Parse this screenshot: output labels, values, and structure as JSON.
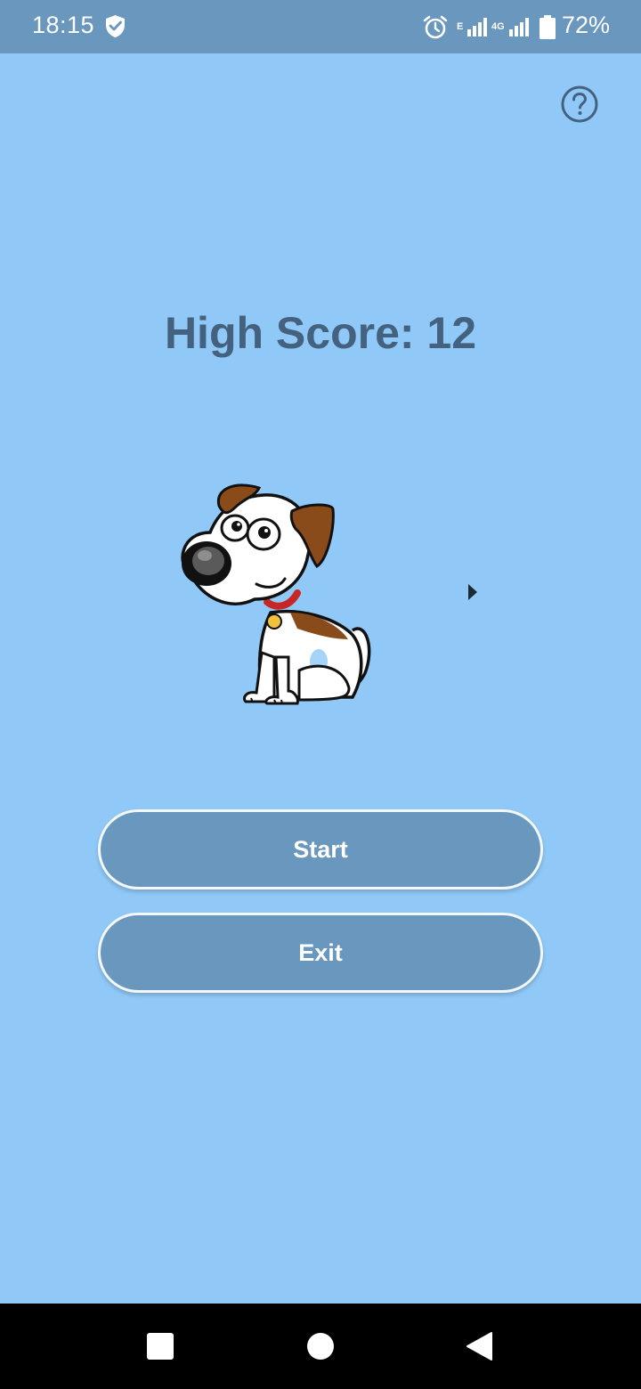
{
  "status_bar": {
    "time": "18:15",
    "network_e": "E",
    "network_4g": "4G",
    "battery_percent": "72%",
    "icons": [
      "shield-icon",
      "alarm-icon",
      "signal-icon",
      "signal-icon",
      "battery-icon"
    ]
  },
  "main": {
    "help_icon": "question-circle-icon",
    "high_score_text": "High Score: 12",
    "mascot": "dog-illustration",
    "start_label": "Start",
    "exit_label": "Exit"
  },
  "nav_bar": {
    "icons": [
      "recents-square-icon",
      "home-circle-icon",
      "back-triangle-icon"
    ]
  },
  "colors": {
    "background": "#90c9f7",
    "bars": "#6a97bd",
    "title_text": "#44627f",
    "button_border": "#f2f8fd"
  }
}
